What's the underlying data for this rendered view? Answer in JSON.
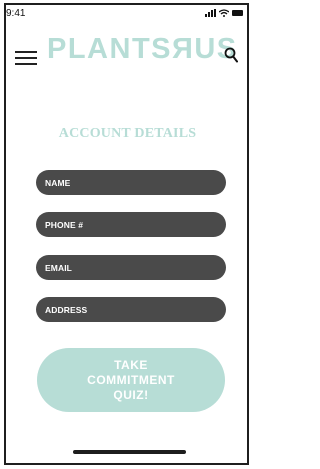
{
  "status_bar": {
    "time": "9:41"
  },
  "header": {
    "menu_icon": "hamburger-menu-icon",
    "brand": "PLANTSЯUS",
    "search_icon": "search-icon"
  },
  "account_details": {
    "title": "ACCOUNT DETAILS",
    "fields": [
      {
        "label": "NAME"
      },
      {
        "label": "PHONE #"
      },
      {
        "label": "EMAIL"
      },
      {
        "label": "ADDRESS"
      }
    ]
  },
  "cta": {
    "line1": "TAKE",
    "line2": "COMMITMENT",
    "line3": "QUIZ!"
  },
  "colors": {
    "accent": "#b7ddd6",
    "field_bg": "#4a4a4a",
    "text_on_field": "#ffffff"
  }
}
